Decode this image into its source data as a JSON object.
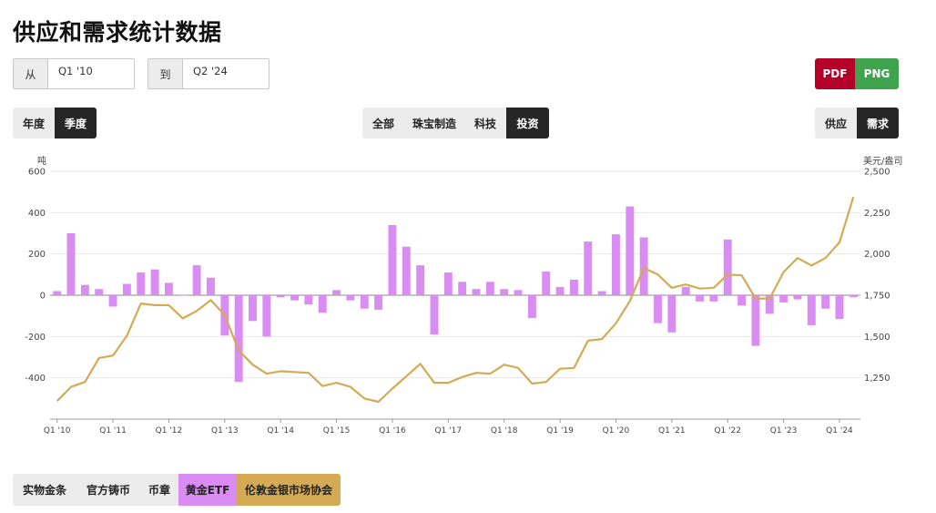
{
  "page": {
    "title": "供应和需求统计数据"
  },
  "range": {
    "from_label": "从",
    "from_value": "Q1 '10",
    "to_label": "到",
    "to_value": "Q2 '24"
  },
  "export": {
    "pdf": "PDF",
    "png": "PNG",
    "pdf_color": "#b5002a",
    "png_color": "#3fa34d"
  },
  "period_toggle": {
    "options": [
      "年度",
      "季度"
    ],
    "active": 1
  },
  "sector_toggle": {
    "options": [
      "全部",
      "珠宝制造",
      "科技",
      "投资"
    ],
    "active": 3
  },
  "side_toggle": {
    "options": [
      "供应",
      "需求"
    ],
    "active": 1
  },
  "legend": {
    "items": [
      {
        "label": "实物金条",
        "active": false,
        "color": "#ececec"
      },
      {
        "label": "官方铸币",
        "active": false,
        "color": "#ececec"
      },
      {
        "label": "币章",
        "active": false,
        "color": "#ececec"
      },
      {
        "label": "黄金ETF",
        "active": true,
        "color": "#d98cf2"
      },
      {
        "label": "伦敦金银市场协会",
        "active": true,
        "color": "#d4aa55"
      }
    ]
  },
  "chart_data": {
    "type": "bar",
    "categories": [
      "Q1 '10",
      "Q2 '10",
      "Q3 '10",
      "Q4 '10",
      "Q1 '11",
      "Q2 '11",
      "Q3 '11",
      "Q4 '11",
      "Q1 '12",
      "Q2 '12",
      "Q3 '12",
      "Q4 '12",
      "Q1 '13",
      "Q2 '13",
      "Q3 '13",
      "Q4 '13",
      "Q1 '14",
      "Q2 '14",
      "Q3 '14",
      "Q4 '14",
      "Q1 '15",
      "Q2 '15",
      "Q3 '15",
      "Q4 '15",
      "Q1 '16",
      "Q2 '16",
      "Q3 '16",
      "Q4 '16",
      "Q1 '17",
      "Q2 '17",
      "Q3 '17",
      "Q4 '17",
      "Q1 '18",
      "Q2 '18",
      "Q3 '18",
      "Q4 '18",
      "Q1 '19",
      "Q2 '19",
      "Q3 '19",
      "Q4 '19",
      "Q1 '20",
      "Q2 '20",
      "Q3 '20",
      "Q4 '20",
      "Q1 '21",
      "Q2 '21",
      "Q3 '21",
      "Q4 '21",
      "Q1 '22",
      "Q2 '22",
      "Q3 '22",
      "Q4 '22",
      "Q1 '23",
      "Q2 '23",
      "Q3 '23",
      "Q4 '23",
      "Q1 '24",
      "Q2 '24"
    ],
    "x_tick_labels": [
      "Q1 '10",
      "Q1 '11",
      "Q1 '12",
      "Q1 '13",
      "Q1 '14",
      "Q1 '15",
      "Q1 '16",
      "Q1 '17",
      "Q1 '18",
      "Q1 '19",
      "Q1 '20",
      "Q1 '21",
      "Q1 '22",
      "Q1 '23",
      "Q1 '24"
    ],
    "series": [
      {
        "name": "黄金ETF",
        "type": "bar",
        "axis": "left",
        "color": "#d98cf2",
        "values": [
          20,
          300,
          50,
          30,
          -55,
          55,
          110,
          125,
          60,
          0,
          145,
          85,
          -195,
          -420,
          -125,
          -200,
          -10,
          -25,
          -45,
          -85,
          25,
          -25,
          -65,
          -70,
          340,
          235,
          145,
          -190,
          110,
          65,
          30,
          65,
          30,
          25,
          -110,
          115,
          40,
          75,
          260,
          20,
          295,
          430,
          280,
          -135,
          -180,
          40,
          -30,
          -30,
          270,
          -50,
          -245,
          -90,
          -35,
          -20,
          -145,
          -65,
          -115,
          -10
        ]
      },
      {
        "name": "伦敦金银市场协会",
        "type": "line",
        "axis": "right",
        "color": "#d4aa55",
        "values": [
          1110,
          1195,
          1225,
          1370,
          1385,
          1505,
          1700,
          1690,
          1690,
          1610,
          1655,
          1720,
          1630,
          1415,
          1330,
          1275,
          1290,
          1285,
          1280,
          1200,
          1220,
          1195,
          1125,
          1105,
          1185,
          1260,
          1335,
          1220,
          1220,
          1255,
          1280,
          1275,
          1330,
          1310,
          1215,
          1225,
          1305,
          1310,
          1475,
          1485,
          1580,
          1715,
          1915,
          1875,
          1795,
          1815,
          1790,
          1795,
          1875,
          1870,
          1730,
          1730,
          1890,
          1975,
          1930,
          1975,
          2070,
          2345
        ]
      }
    ],
    "ylabel": "吨",
    "ylabel_right": "美元/盎司",
    "ylim": [
      -600,
      600
    ],
    "ylim_right": [
      1000,
      2500
    ],
    "y_ticks": [
      600,
      400,
      200,
      0,
      -200,
      -400
    ],
    "y_ticks_right": [
      "2,500",
      "2,250",
      "2,000",
      "1,750",
      "1,500",
      "1,250"
    ],
    "grid": true
  }
}
